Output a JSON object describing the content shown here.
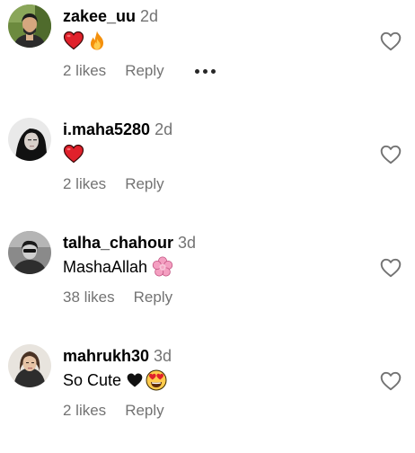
{
  "comments": [
    {
      "username": "zakee_uu",
      "time": "2d",
      "text": "",
      "emojis": [
        "red-heart",
        "fire"
      ],
      "likes": "2 likes",
      "reply": "Reply",
      "has_more": true
    },
    {
      "username": "i.maha5280",
      "time": "2d",
      "text": "",
      "emojis": [
        "red-heart"
      ],
      "likes": "2 likes",
      "reply": "Reply",
      "has_more": false
    },
    {
      "username": "talha_chahour",
      "time": "3d",
      "text": "MashaAllah",
      "emojis": [
        "pink-flower"
      ],
      "likes": "38 likes",
      "reply": "Reply",
      "has_more": false
    },
    {
      "username": "mahrukh30",
      "time": "3d",
      "text": "So Cute",
      "emojis": [
        "black-heart",
        "heart-eyes-face"
      ],
      "likes": "2 likes",
      "reply": "Reply",
      "has_more": false
    }
  ],
  "icons": {
    "like": "heart-outline-icon",
    "more": "more-options-icon"
  },
  "colors": {
    "secondary_text": "#737373",
    "red_heart": "#e0212b",
    "fire_orange": "#f4900c",
    "pink_flower": "#f49fc1",
    "emoji_yellow": "#ffcb4c"
  }
}
